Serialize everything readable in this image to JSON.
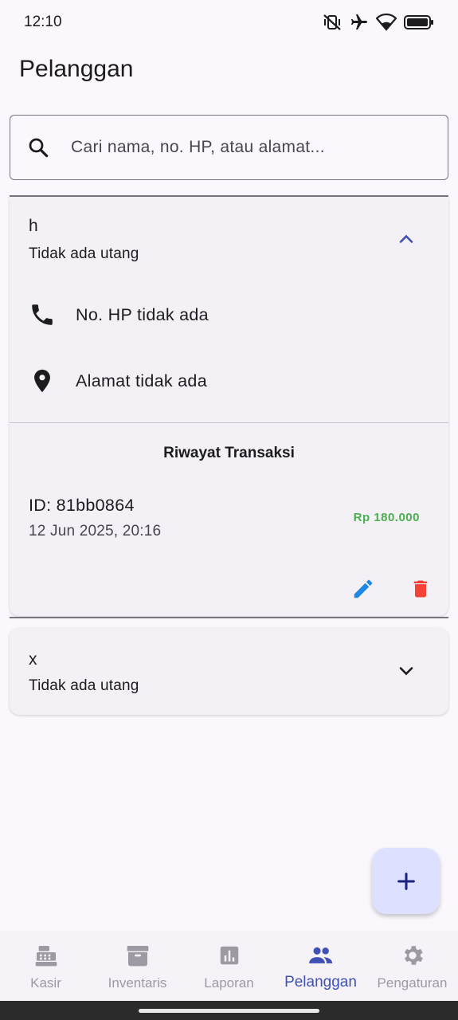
{
  "status_bar": {
    "time": "12:10",
    "icons": [
      "vibrate-off-icon",
      "airplane-icon",
      "wifi-icon",
      "battery-icon"
    ]
  },
  "app_bar": {
    "title": "Pelanggan"
  },
  "search": {
    "placeholder": "Cari nama, no. HP, atau alamat..."
  },
  "customers": [
    {
      "name": "h",
      "debt_status": "Tidak ada utang",
      "expanded": true,
      "phone": "No. HP tidak ada",
      "address": "Alamat tidak ada",
      "history_title": "Riwayat Transaksi",
      "transactions": [
        {
          "id": "ID: 81bb0864",
          "date": "12 Jun 2025, 20:16",
          "amount": "Rp 180.000"
        }
      ]
    },
    {
      "name": "x",
      "debt_status": "Tidak ada utang",
      "expanded": false
    }
  ],
  "fab": {
    "icon": "plus-icon"
  },
  "bottom_nav": {
    "items": [
      {
        "label": "Kasir",
        "icon": "cash-register-icon",
        "active": false
      },
      {
        "label": "Inventaris",
        "icon": "archive-box-icon",
        "active": false
      },
      {
        "label": "Laporan",
        "icon": "bar-chart-icon",
        "active": false
      },
      {
        "label": "Pelanggan",
        "icon": "people-icon",
        "active": true
      },
      {
        "label": "Pengaturan",
        "icon": "gear-icon",
        "active": false
      }
    ]
  },
  "colors": {
    "primary": "#3f51b5",
    "edit": "#1e88e5",
    "delete": "#f44336",
    "amount": "#4caf50",
    "fab_bg": "#dde1ff",
    "background": "#fbf8fd"
  }
}
